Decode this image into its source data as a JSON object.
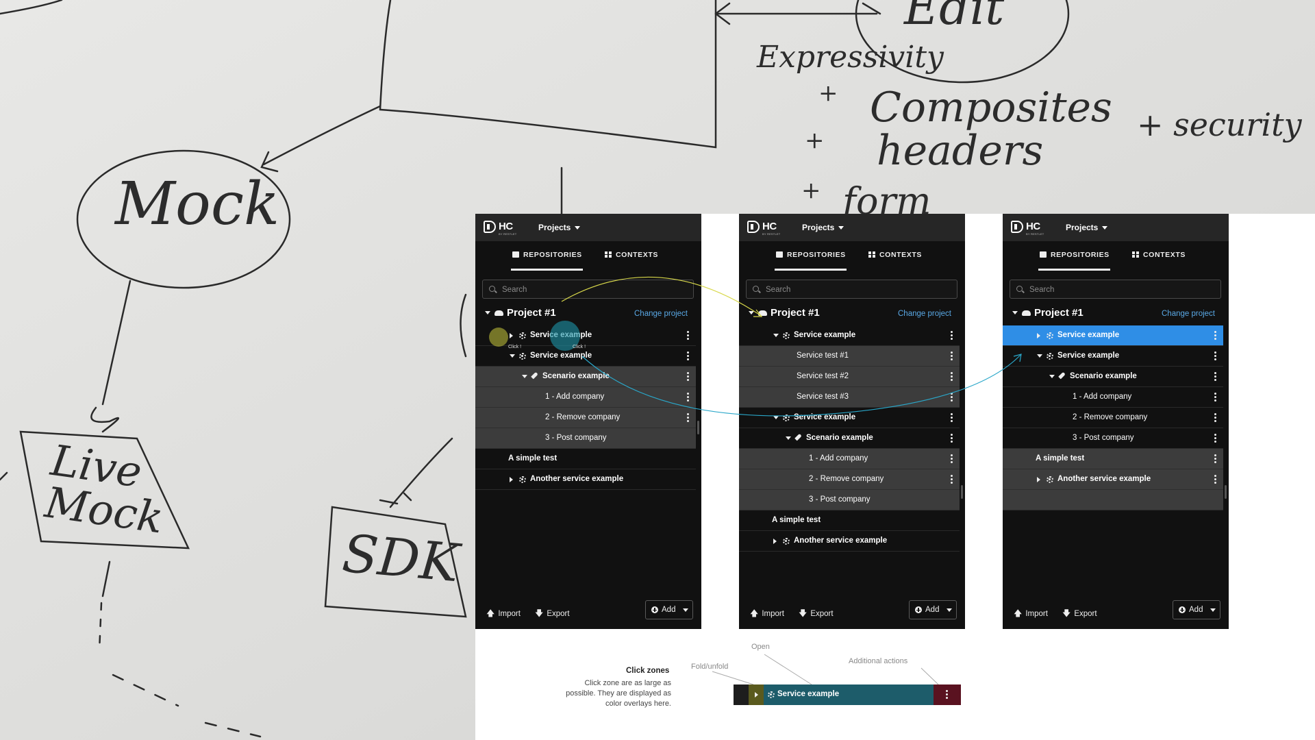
{
  "whiteboard": {
    "words": [
      "Edit",
      "Expressivity",
      "+",
      "Composites",
      "+ security",
      "+",
      "headers",
      "+",
      "form",
      "Mock",
      "Live Mock",
      "SDK"
    ]
  },
  "panels": [
    {
      "logo_text": "HC",
      "logo_sub": "BY RESTLET",
      "projects_label": "Projects",
      "tabs": [
        "REPOSITORIES",
        "CONTEXTS"
      ],
      "search_placeholder": "Search",
      "project_title": "Project #1",
      "change_project": "Change project",
      "rows": [
        {
          "label": "Service example",
          "indent": 1,
          "toggle": "right",
          "icon": "gear-icon",
          "bold": true,
          "menu": true,
          "tone": "dark"
        },
        {
          "label": "Service example",
          "indent": 1,
          "toggle": "down",
          "icon": "gear-icon",
          "bold": true,
          "menu": true,
          "tone": "dark"
        },
        {
          "label": "Scenario example",
          "indent": 2,
          "toggle": "down",
          "icon": "rocket-icon",
          "bold": true,
          "menu": true,
          "tone": "light"
        },
        {
          "label": "1 - Add company",
          "indent": 3,
          "toggle": "",
          "icon": "",
          "bold": false,
          "menu": true,
          "tone": "light"
        },
        {
          "label": "2 - Remove company",
          "indent": 3,
          "toggle": "",
          "icon": "",
          "bold": false,
          "menu": true,
          "tone": "light"
        },
        {
          "label": "3 - Post company",
          "indent": 3,
          "toggle": "",
          "icon": "",
          "bold": false,
          "menu": false,
          "tone": "light"
        },
        {
          "label": "A simple test",
          "indent": 0,
          "toggle": "",
          "icon": "",
          "bold": true,
          "menu": false,
          "tone": "dark"
        },
        {
          "label": "Another service example",
          "indent": 1,
          "toggle": "right",
          "icon": "gear-icon",
          "bold": true,
          "menu": false,
          "tone": "dark"
        }
      ],
      "click_labels": [
        "Click !",
        "Click !"
      ],
      "footer": {
        "import": "Import",
        "export": "Export",
        "add": "Add"
      }
    },
    {
      "logo_text": "HC",
      "logo_sub": "BY RESTLET",
      "projects_label": "Projects",
      "tabs": [
        "REPOSITORIES",
        "CONTEXTS"
      ],
      "search_placeholder": "Search",
      "project_title": "Project #1",
      "change_project": "Change project",
      "rows": [
        {
          "label": "Service example",
          "indent": 1,
          "toggle": "down",
          "icon": "gear-icon",
          "bold": true,
          "menu": true,
          "tone": "dark"
        },
        {
          "label": "Service test #1",
          "indent": 2,
          "toggle": "",
          "icon": "",
          "bold": false,
          "menu": true,
          "tone": "light"
        },
        {
          "label": "Service test #2",
          "indent": 2,
          "toggle": "",
          "icon": "",
          "bold": false,
          "menu": true,
          "tone": "light"
        },
        {
          "label": "Service test #3",
          "indent": 2,
          "toggle": "",
          "icon": "",
          "bold": false,
          "menu": true,
          "tone": "light"
        },
        {
          "label": "Service example",
          "indent": 1,
          "toggle": "down",
          "icon": "gear-icon",
          "bold": true,
          "menu": true,
          "tone": "dark"
        },
        {
          "label": "Scenario example",
          "indent": 2,
          "toggle": "down",
          "icon": "rocket-icon",
          "bold": true,
          "menu": true,
          "tone": "dark"
        },
        {
          "label": "1 - Add company",
          "indent": 3,
          "toggle": "",
          "icon": "",
          "bold": false,
          "menu": true,
          "tone": "light"
        },
        {
          "label": "2 - Remove company",
          "indent": 3,
          "toggle": "",
          "icon": "",
          "bold": false,
          "menu": true,
          "tone": "light"
        },
        {
          "label": "3 - Post company",
          "indent": 3,
          "toggle": "",
          "icon": "",
          "bold": false,
          "menu": false,
          "tone": "light"
        },
        {
          "label": "A simple test",
          "indent": 0,
          "toggle": "",
          "icon": "",
          "bold": true,
          "menu": false,
          "tone": "dark"
        },
        {
          "label": "Another service example",
          "indent": 1,
          "toggle": "right",
          "icon": "gear-icon",
          "bold": true,
          "menu": false,
          "tone": "dark"
        }
      ],
      "footer": {
        "import": "Import",
        "export": "Export",
        "add": "Add"
      }
    },
    {
      "logo_text": "HC",
      "logo_sub": "BY RESTLET",
      "projects_label": "Projects",
      "tabs": [
        "REPOSITORIES",
        "CONTEXTS"
      ],
      "search_placeholder": "Search",
      "project_title": "Project #1",
      "change_project": "Change project",
      "rows": [
        {
          "label": "Service example",
          "indent": 1,
          "toggle": "right",
          "icon": "gear-icon",
          "bold": true,
          "menu": true,
          "tone": "selected"
        },
        {
          "label": "Service example",
          "indent": 1,
          "toggle": "down",
          "icon": "gear-icon",
          "bold": true,
          "menu": true,
          "tone": "dark"
        },
        {
          "label": "Scenario example",
          "indent": 2,
          "toggle": "down",
          "icon": "rocket-icon",
          "bold": true,
          "menu": true,
          "tone": "dark"
        },
        {
          "label": "1 - Add company",
          "indent": 3,
          "toggle": "",
          "icon": "",
          "bold": false,
          "menu": true,
          "tone": "dark"
        },
        {
          "label": "2 - Remove company",
          "indent": 3,
          "toggle": "",
          "icon": "",
          "bold": false,
          "menu": true,
          "tone": "dark"
        },
        {
          "label": "3 - Post company",
          "indent": 3,
          "toggle": "",
          "icon": "",
          "bold": false,
          "menu": true,
          "tone": "dark"
        },
        {
          "label": "A simple test",
          "indent": 0,
          "toggle": "",
          "icon": "",
          "bold": true,
          "menu": true,
          "tone": "light"
        },
        {
          "label": "Another service example",
          "indent": 1,
          "toggle": "right",
          "icon": "gear-icon",
          "bold": true,
          "menu": true,
          "tone": "light"
        },
        {
          "label": "",
          "indent": 0,
          "toggle": "",
          "icon": "",
          "bold": false,
          "menu": false,
          "tone": "empty"
        }
      ],
      "footer": {
        "import": "Import",
        "export": "Export",
        "add": "Add"
      }
    }
  ],
  "legend": {
    "title": "Click zones",
    "description": "Click zone are as large as possible. They are displayed as color overlays here.",
    "open": "Open",
    "fold": "Fold/unfold",
    "additional": "Additional actions",
    "demo_label": "Service example"
  },
  "colors": {
    "selected": "#2f8ee6",
    "link": "#5aa9e6",
    "arrow_yellow": "#d8d84a",
    "arrow_cyan": "#2aa7c9",
    "fold_zone": "#5a5a1e",
    "open_zone": "#1d5c6a",
    "actions_zone": "#5a1220"
  }
}
